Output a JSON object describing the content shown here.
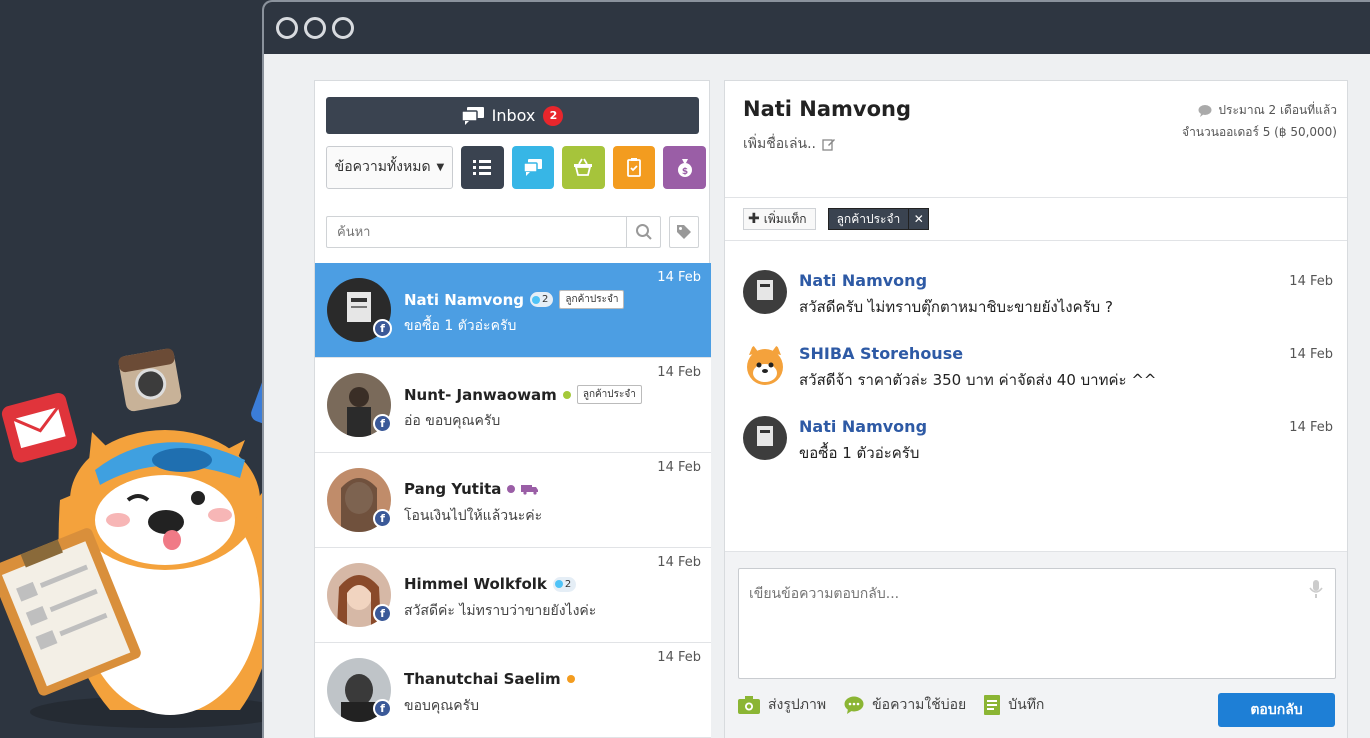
{
  "inbox": {
    "label": "Inbox",
    "badge": "2"
  },
  "filter": {
    "label": "ข้อความทั้งหมด"
  },
  "search": {
    "placeholder": "ค้นหา"
  },
  "conversations": [
    {
      "name": "Nati Namvong",
      "message": "ขอซื้อ 1 ตัวอ่ะครับ",
      "date": "14 Feb",
      "count": "2",
      "tag": "ลูกค้าประจำ",
      "active": true
    },
    {
      "name": "Nunt- Janwaowam",
      "message": "อ่อ ขอบคุณครับ",
      "date": "14 Feb",
      "tag": "ลูกค้าประจำ",
      "status_color": "#a4c93a"
    },
    {
      "name": "Pang Yutita",
      "message": "โอนเงินไปให้แล้วนะค่ะ",
      "date": "14 Feb",
      "status_color": "#9a5ea6"
    },
    {
      "name": "Himmel Wolkfolk",
      "message": "สวัสดีค่ะ ไม่ทราบว่าขายยังไงค่ะ",
      "date": "14 Feb",
      "count": "2"
    },
    {
      "name": "Thanutchai Saelim",
      "message": "ขอบคุณครับ",
      "date": "14 Feb",
      "status_color": "#f39c1f"
    }
  ],
  "contact": {
    "name": "Nati Namvong",
    "nickname_placeholder": "เพิ่มชื่อเล่น..",
    "last_seen": "ประมาณ 2 เดือนที่แล้ว",
    "orders": "จำนวนออเดอร์  5 (฿ 50,000)",
    "add_tag": "เพิ่มแท็ก",
    "tag": "ลูกค้าประจำ"
  },
  "messages": [
    {
      "sender": "Nati Namvong",
      "text": "สวัสดีครับ ไม่ทราบตุ๊กตาหมาชิบะขายยังไงครับ ?",
      "date": "14 Feb"
    },
    {
      "sender": "SHIBA Storehouse",
      "text": "สวัสดีจ้า ราคาตัวล่ะ 350 บาท ค่าจัดส่ง 40 บาทค่ะ ^^",
      "date": "14 Feb"
    },
    {
      "sender": "Nati Namvong",
      "text": "ขอซื้อ 1 ตัวอ่ะครับ",
      "date": "14 Feb"
    }
  ],
  "reply": {
    "placeholder": "เขียนข้อความตอบกลับ...",
    "send_photo": "ส่งรูปภาพ",
    "quick_reply": "ข้อความใช้บ่อย",
    "note": "บันทึก",
    "send": "ตอบกลับ"
  },
  "colors": {
    "accent": "#4c9ee3",
    "dark": "#3a4350",
    "send": "#1e7fd6",
    "name_link": "#2e5aa5"
  }
}
